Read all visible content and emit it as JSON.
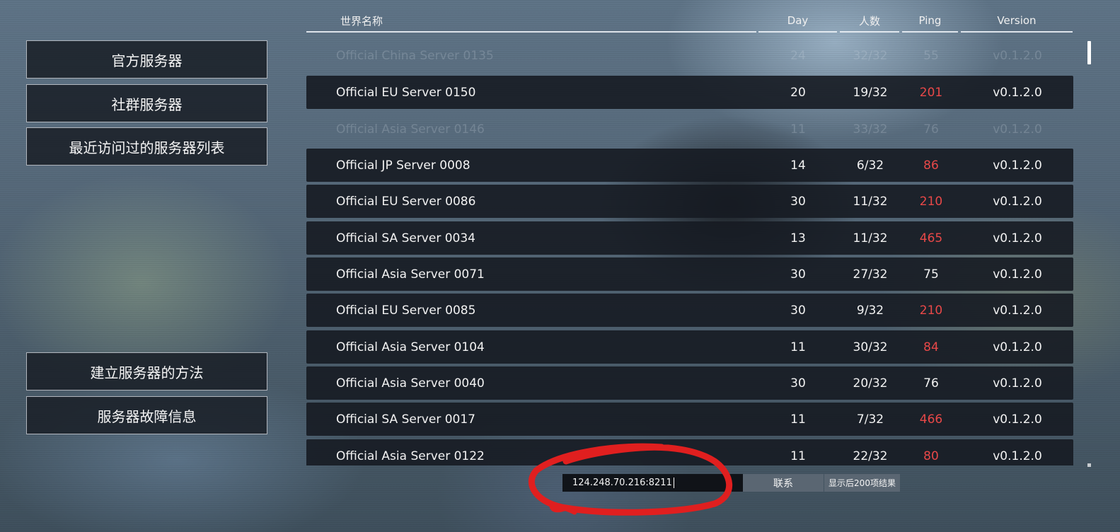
{
  "colors": {
    "ping_high": "#e84848",
    "row_bg": "#16191f",
    "annotation_red": "#e01f1f"
  },
  "sidebar": {
    "top_items": [
      {
        "label": "官方服务器"
      },
      {
        "label": "社群服务器"
      },
      {
        "label": "最近访问过的服务器列表"
      }
    ],
    "bottom_items": [
      {
        "label": "建立服务器的方法"
      },
      {
        "label": "服务器故障信息"
      }
    ]
  },
  "table": {
    "headers": {
      "name": "世界名称",
      "day": "Day",
      "players": "人数",
      "ping": "Ping",
      "version": "Version"
    },
    "rows": [
      {
        "name": "Official China Server 0135",
        "day": "24",
        "players": "32/32",
        "ping": "55",
        "version": "v0.1.2.0",
        "faded": true,
        "ping_high": false
      },
      {
        "name": "Official EU Server 0150",
        "day": "20",
        "players": "19/32",
        "ping": "201",
        "version": "v0.1.2.0",
        "faded": false,
        "ping_high": true
      },
      {
        "name": "Official Asia Server 0146",
        "day": "11",
        "players": "33/32",
        "ping": "76",
        "version": "v0.1.2.0",
        "faded": true,
        "ping_high": false
      },
      {
        "name": "Official JP Server 0008",
        "day": "14",
        "players": "6/32",
        "ping": "86",
        "version": "v0.1.2.0",
        "faded": false,
        "ping_high": true
      },
      {
        "name": "Official EU Server 0086",
        "day": "30",
        "players": "11/32",
        "ping": "210",
        "version": "v0.1.2.0",
        "faded": false,
        "ping_high": true
      },
      {
        "name": "Official SA Server 0034",
        "day": "13",
        "players": "11/32",
        "ping": "465",
        "version": "v0.1.2.0",
        "faded": false,
        "ping_high": true
      },
      {
        "name": "Official Asia Server 0071",
        "day": "30",
        "players": "27/32",
        "ping": "75",
        "version": "v0.1.2.0",
        "faded": false,
        "ping_high": false
      },
      {
        "name": "Official EU Server 0085",
        "day": "30",
        "players": "9/32",
        "ping": "210",
        "version": "v0.1.2.0",
        "faded": false,
        "ping_high": true
      },
      {
        "name": "Official Asia Server 0104",
        "day": "11",
        "players": "30/32",
        "ping": "84",
        "version": "v0.1.2.0",
        "faded": false,
        "ping_high": true
      },
      {
        "name": "Official Asia Server 0040",
        "day": "30",
        "players": "20/32",
        "ping": "76",
        "version": "v0.1.2.0",
        "faded": false,
        "ping_high": false
      },
      {
        "name": "Official SA Server 0017",
        "day": "11",
        "players": "7/32",
        "ping": "466",
        "version": "v0.1.2.0",
        "faded": false,
        "ping_high": true
      },
      {
        "name": "Official Asia Server 0122",
        "day": "11",
        "players": "22/32",
        "ping": "80",
        "version": "v0.1.2.0",
        "faded": false,
        "ping_high": true
      }
    ]
  },
  "connect_bar": {
    "ip_value": "124.248.70.216:8211",
    "connect_label": "联系",
    "more_label": "显示后200项结果"
  }
}
